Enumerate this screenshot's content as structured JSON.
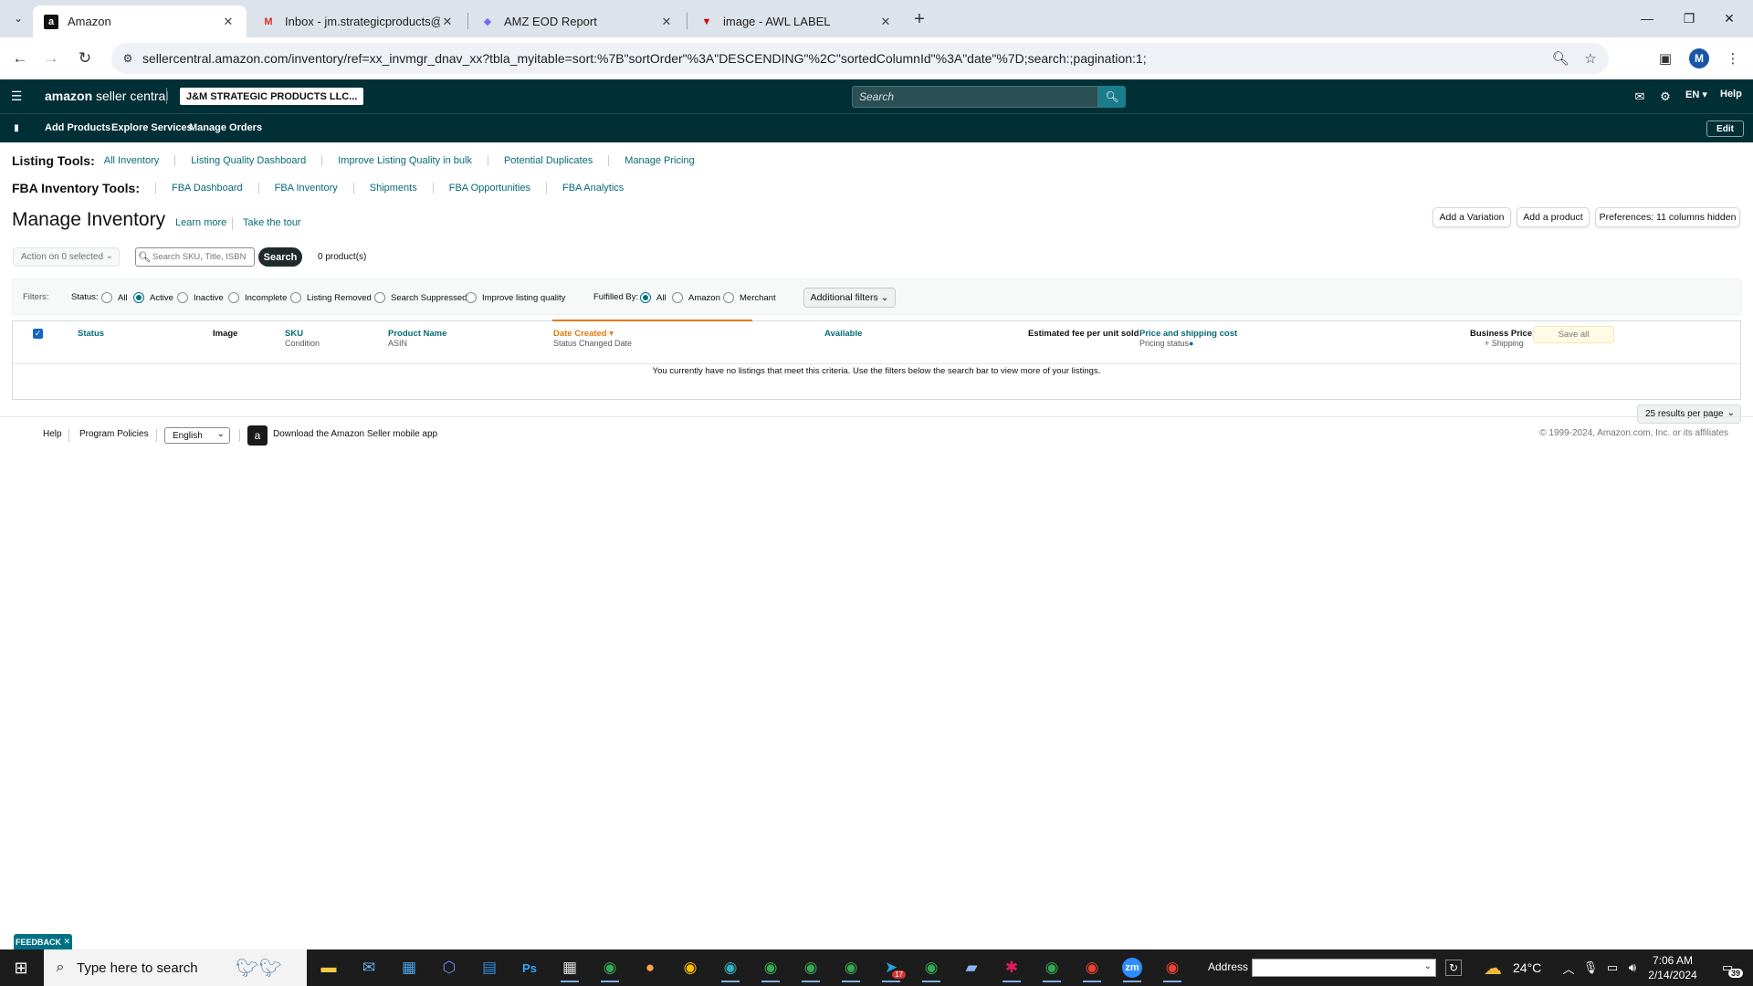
{
  "browser": {
    "tabs": [
      {
        "title": "Amazon",
        "favicon": "amazon-icon",
        "active": true
      },
      {
        "title": "Inbox - jm.strategicproducts@g",
        "favicon": "gmail-icon",
        "active": false
      },
      {
        "title": "AMZ EOD Report",
        "favicon": "clickup-icon",
        "active": false
      },
      {
        "title": "image - AWL LABEL",
        "favicon": "tripadvisor-icon",
        "active": false
      }
    ],
    "url": "sellercentral.amazon.com/inventory/ref=xx_invmgr_dnav_xx?tbla_myitable=sort:%7B\"sortOrder\"%3A\"DESCENDING\"%2C\"sortedColumnId\"%3A\"date\"%7D;search:;pagination:1;",
    "profile_initial": "M"
  },
  "header": {
    "logo_brand": "amazon",
    "logo_product": "seller central",
    "account_name": "J&M STRATEGIC PRODUCTS LLC...",
    "search_placeholder": "Search",
    "language": "EN",
    "help": "Help"
  },
  "subnav": {
    "links": [
      "Add Products",
      "Explore Services",
      "Manage Orders"
    ],
    "edit": "Edit"
  },
  "listing_tools": {
    "label": "Listing Tools:",
    "links": [
      "All Inventory",
      "Listing Quality Dashboard",
      "Improve Listing Quality in bulk",
      "Potential Duplicates",
      "Manage Pricing"
    ]
  },
  "fba_tools": {
    "label": "FBA Inventory Tools:",
    "links": [
      "FBA Dashboard",
      "FBA Inventory",
      "Shipments",
      "FBA Opportunities",
      "FBA Analytics"
    ]
  },
  "page": {
    "title": "Manage Inventory",
    "learn_more": "Learn more",
    "take_tour": "Take the tour",
    "buttons": {
      "add_variation": "Add a Variation",
      "add_product": "Add a product",
      "preferences": "Preferences: 11 columns hidden"
    }
  },
  "actions": {
    "action_select": "Action on 0 selected",
    "search_placeholder": "Search SKU, Title, ISBN",
    "search_button": "Search",
    "product_count": "0 product(s)"
  },
  "filters": {
    "label": "Filters:",
    "status_label": "Status:",
    "status_options": [
      "All",
      "Active",
      "Inactive",
      "Incomplete",
      "Listing Removed",
      "Search Suppressed",
      "Improve listing quality"
    ],
    "status_selected": "Active",
    "fulfilled_label": "Fulfilled By:",
    "fulfilled_options": [
      "All",
      "Amazon",
      "Merchant"
    ],
    "fulfilled_selected": "All",
    "additional": "Additional filters"
  },
  "table": {
    "columns": {
      "status": "Status",
      "image": "Image",
      "sku": "SKU",
      "sku_sub": "Condition",
      "product_name": "Product Name",
      "product_name_sub": "ASIN",
      "date_created": "Date Created",
      "date_created_sub": "Status Changed Date",
      "available": "Available",
      "est_fee": "Estimated fee per unit sold",
      "price": "Price and shipping cost",
      "price_sub": "Pricing status",
      "business_price": "Business Price",
      "business_price_sub": "+ Shipping"
    },
    "save_all": "Save all",
    "empty_message": "You currently have no listings that meet this criteria. Use the filters below the search bar to view more of your listings.",
    "per_page": "25 results per page"
  },
  "footer": {
    "help": "Help",
    "program_policies": "Program Policies",
    "language": "English",
    "download_app": "Download the Amazon Seller mobile app",
    "copyright": "© 1999-2024, Amazon.com, Inc. or its affiliates"
  },
  "feedback": "FEEDBACK",
  "taskbar": {
    "search_placeholder": "Type here to search",
    "address_label": "Address",
    "temperature": "24°C",
    "time": "7:06 AM",
    "date": "2/14/2024",
    "notification_count": "39",
    "telegram_badge": "17"
  },
  "colors": {
    "header_bg": "#002f36",
    "link": "#076a75",
    "sort_accent": "#e47911",
    "search_btn": "#222b2b"
  }
}
